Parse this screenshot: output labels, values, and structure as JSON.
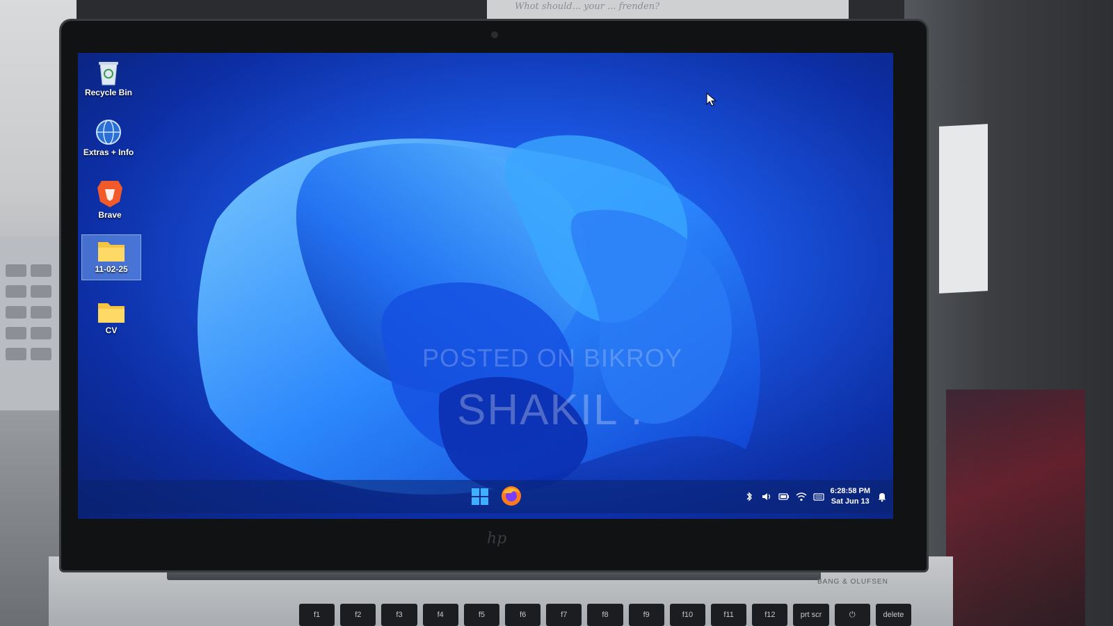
{
  "desktop": {
    "icons": [
      {
        "label": "Recycle Bin",
        "icon": "recycle-bin-icon"
      },
      {
        "label": "Extras + Info",
        "icon": "globe-info-icon"
      },
      {
        "label": "Brave",
        "icon": "brave-lion-icon"
      },
      {
        "label": "11-02-25",
        "icon": "folder-icon",
        "selected": true
      },
      {
        "label": "CV",
        "icon": "folder-icon"
      }
    ],
    "watermark_line1": "POSTED ON BIKROY",
    "watermark_line2": "SHAKIL ."
  },
  "taskbar": {
    "pinned": [
      "windows-start-icon",
      "firefox-icon"
    ],
    "tray_icons": [
      "bluetooth-icon",
      "volume-icon",
      "battery-icon",
      "wifi-icon",
      "keyboard-icon",
      "notification-bell-icon"
    ],
    "time": "6:28:58 PM",
    "date": "Sat Jun 13"
  },
  "laptop": {
    "brand_text": "BANG & OLUFSEN",
    "keys": [
      "f1",
      "f2",
      "f3",
      "f4",
      "f5",
      "f6",
      "f7",
      "f8",
      "f9",
      "f10",
      "f11",
      "f12",
      "prt scr",
      "⏻",
      "delete"
    ]
  },
  "background_note": "Whot should... your ... frenden?",
  "colors": {
    "accent": "#1a55e0",
    "taskbar": "#0a236e"
  }
}
